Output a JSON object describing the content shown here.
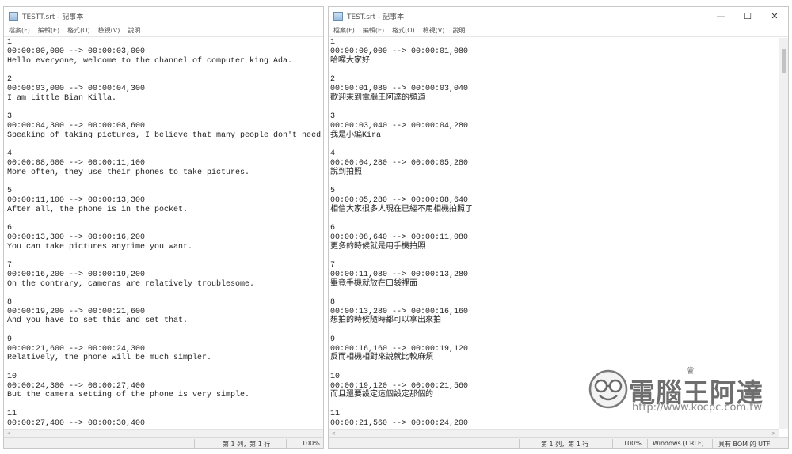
{
  "left_window": {
    "title": "TESTT.srt - 記事本",
    "menu": [
      "檔案(F)",
      "編輯(E)",
      "格式(O)",
      "檢視(V)",
      "說明"
    ],
    "blocks": [
      {
        "index": "1",
        "time": "00:00:00,000 --> 00:00:03,000",
        "text": "Hello everyone, welcome to the channel of computer king Ada."
      },
      {
        "index": "2",
        "time": "00:00:03,000 --> 00:00:04,300",
        "text": "I am Little Bian Killa."
      },
      {
        "index": "3",
        "time": "00:00:04,300 --> 00:00:08,600",
        "text": "Speaking of taking pictures, I believe that many people don't need c"
      },
      {
        "index": "4",
        "time": "00:00:08,600 --> 00:00:11,100",
        "text": "More often, they use their phones to take pictures."
      },
      {
        "index": "5",
        "time": "00:00:11,100 --> 00:00:13,300",
        "text": "After all, the phone is in the pocket."
      },
      {
        "index": "6",
        "time": "00:00:13,300 --> 00:00:16,200",
        "text": "You can take pictures anytime you want."
      },
      {
        "index": "7",
        "time": "00:00:16,200 --> 00:00:19,200",
        "text": "On the contrary, cameras are relatively troublesome."
      },
      {
        "index": "8",
        "time": "00:00:19,200 --> 00:00:21,600",
        "text": "And you have to set this and set that."
      },
      {
        "index": "9",
        "time": "00:00:21,600 --> 00:00:24,300",
        "text": "Relatively, the phone will be much simpler."
      },
      {
        "index": "10",
        "time": "00:00:24,300 --> 00:00:27,400",
        "text": "But the camera setting of the phone is very simple."
      },
      {
        "index": "11",
        "time": "00:00:27,400 --> 00:00:30,400",
        "text": ""
      }
    ],
    "status": {
      "position": "第 1 列，第 1 行",
      "zoom": "100%"
    }
  },
  "right_window": {
    "title": "TEST.srt - 記事本",
    "controls": {
      "minimize": "—",
      "maximize": "☐",
      "close": "✕"
    },
    "menu": [
      "檔案(F)",
      "編輯(E)",
      "格式(O)",
      "檢視(V)",
      "說明"
    ],
    "blocks": [
      {
        "index": "1",
        "time": "00:00:00,000 --> 00:00:01,080",
        "text": "哈囉大家好"
      },
      {
        "index": "2",
        "time": "00:00:01,080 --> 00:00:03,040",
        "text": "歡迎來到電腦王阿達的頻道"
      },
      {
        "index": "3",
        "time": "00:00:03,040 --> 00:00:04,280",
        "text": "我是小編Kira"
      },
      {
        "index": "4",
        "time": "00:00:04,280 --> 00:00:05,280",
        "text": "說到拍照"
      },
      {
        "index": "5",
        "time": "00:00:05,280 --> 00:00:08,640",
        "text": "相信大家很多人現在已經不用相機拍照了"
      },
      {
        "index": "6",
        "time": "00:00:08,640 --> 00:00:11,080",
        "text": "更多的時候就是用手機拍照"
      },
      {
        "index": "7",
        "time": "00:00:11,080 --> 00:00:13,280",
        "text": "畢竟手機就放在口袋裡面"
      },
      {
        "index": "8",
        "time": "00:00:13,280 --> 00:00:16,160",
        "text": "想拍的時候隨時都可以拿出來拍"
      },
      {
        "index": "9",
        "time": "00:00:16,160 --> 00:00:19,120",
        "text": "反而相機相對來說就比較麻煩"
      },
      {
        "index": "10",
        "time": "00:00:19,120 --> 00:00:21,560",
        "text": "而且還要設定這個設定那個的"
      },
      {
        "index": "11",
        "time": "00:00:21,560 --> 00:00:24,200",
        "text": ""
      }
    ],
    "status": {
      "position": "第 1 列，第 1 行",
      "zoom": "100%",
      "line_ending": "Windows (CRLF)",
      "encoding": "具有 BOM 的 UTF"
    }
  },
  "watermark": {
    "name": "電腦王阿達",
    "url": "http://www.kocpc.com.tw"
  }
}
